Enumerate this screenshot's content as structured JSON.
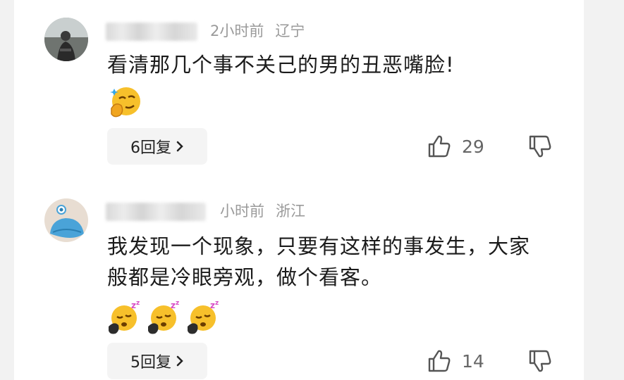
{
  "comments": [
    {
      "time": "2小时前",
      "location": "辽宁",
      "text": "看清那几个事不关己的男的丑恶嘴脸!",
      "emoji": "smirk-hand-emoji",
      "reply_label": "6回复",
      "likes": "29"
    },
    {
      "time": "小时前",
      "location": "浙江",
      "text": "我发现一个现象，只要有这样的事发生，大家般都是冷眼旁观，做个看客。",
      "emoji": "sleepy-zzz-emoji",
      "emoji_count": 3,
      "reply_label": "5回复",
      "likes": "14"
    }
  ],
  "colors": {
    "background": "#ffffff",
    "meta": "#9a9a9a",
    "text": "#1b1b1b",
    "reply_bg": "#f4f4f4"
  }
}
